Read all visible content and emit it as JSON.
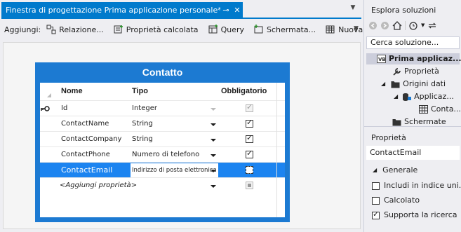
{
  "designer": {
    "tab_title": "Finestra di progettazione Prima applicazione personale*",
    "tab_pin": "⊸",
    "tab_close": "✕",
    "toolbar": {
      "add_label": "Aggiungi:",
      "buttons": [
        "Relazione...",
        "Proprietà calcolata",
        "Query",
        "Schermata...",
        "Nuova tabella"
      ]
    }
  },
  "entity": {
    "title": "Contatto",
    "columns": [
      "Nome",
      "Tipo",
      "Obbligatorio"
    ],
    "rows": [
      {
        "name": "Id",
        "type": "Integer",
        "required": true,
        "key": true
      },
      {
        "name": "ContactName",
        "type": "String",
        "required": true
      },
      {
        "name": "ContactCompany",
        "type": "String",
        "required": true
      },
      {
        "name": "ContactPhone",
        "type": "Numero di telefono",
        "required": true
      },
      {
        "name": "ContactEmail",
        "type": "Indirizzo di posta elettronica",
        "required": false,
        "selected": true
      },
      {
        "name": "<Aggiungi proprietà>",
        "type": "",
        "required": false,
        "placeholder": true
      }
    ]
  },
  "solution_explorer": {
    "title": "Esplora soluzioni",
    "search_placeholder": "Cerca soluzione...",
    "tree": [
      {
        "label": "Prima applicaz...",
        "level": 0
      },
      {
        "label": "Proprietà",
        "level": 1
      },
      {
        "label": "Origini dati",
        "level": 1
      },
      {
        "label": "Applicaz...",
        "level": 2
      },
      {
        "label": "Conta...",
        "level": 3
      },
      {
        "label": "Schermate",
        "level": 1
      }
    ]
  },
  "properties": {
    "title": "Proprietà",
    "object": "ContactEmail",
    "group": "Generale",
    "items": [
      {
        "label": "Includi in indice uni...",
        "checked": false
      },
      {
        "label": "Calcolato",
        "checked": false
      },
      {
        "label": "Supporta la ricerca",
        "checked": true
      }
    ]
  },
  "colors": {
    "accent": "#007acc",
    "entity": "#1c7ad2",
    "selected_row": "#1c84f0"
  }
}
